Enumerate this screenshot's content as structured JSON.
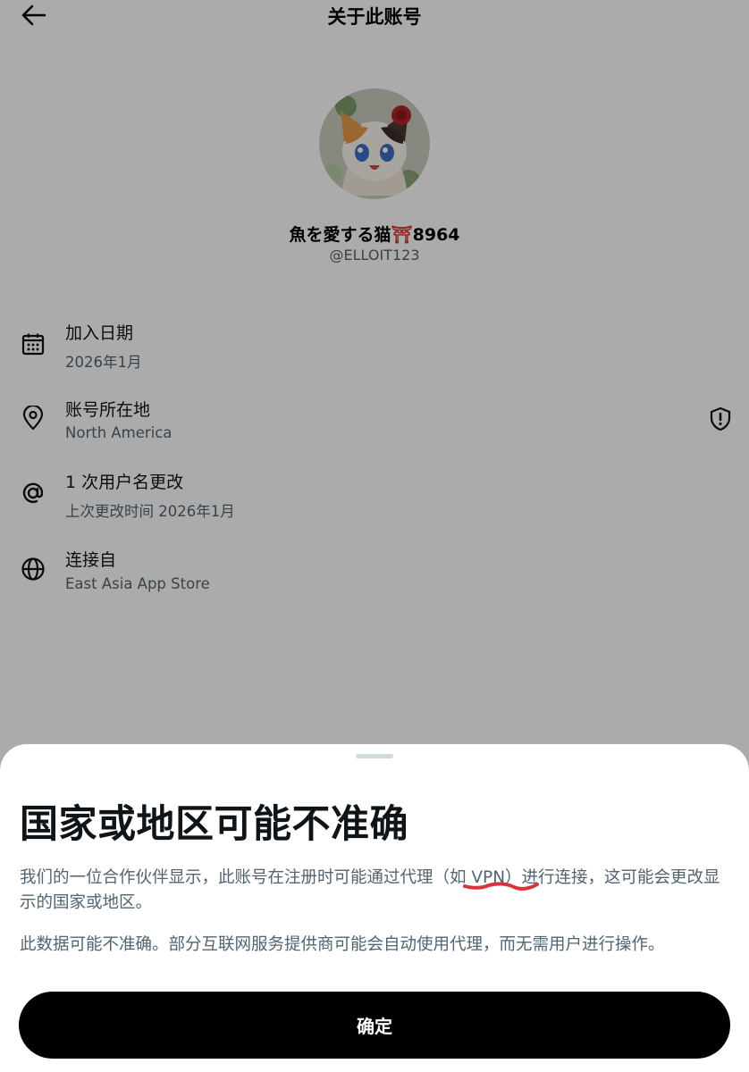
{
  "header": {
    "title": "关于此账号",
    "back_icon": "arrow-left-icon"
  },
  "profile": {
    "display_name": "魚を愛する猫",
    "display_name_emoji": "⛩",
    "display_name_suffix": "8964",
    "handle": "@ELLOIT123"
  },
  "info": [
    {
      "icon": "calendar-icon",
      "title": "加入日期",
      "value": "2026年1月"
    },
    {
      "icon": "location-pin-icon",
      "title": "账号所在地",
      "value": "North America"
    },
    {
      "icon": "at-sign-icon",
      "title": "1 次用户名更改",
      "value": "上次更改时间 2026年1月"
    },
    {
      "icon": "globe-icon",
      "title": "连接自",
      "value": "East Asia App Store"
    }
  ],
  "sheet": {
    "title": "国家或地区可能不准确",
    "paragraph1": "我们的一位合作伙伴显示，此账号在注册时可能通过代理（如 VPN）进行连接，这可能会更改显示的国家或地区。",
    "paragraph2": "此数据可能不准确。部分互联网服务提供商可能会自动使用代理，而无需用户进行操作。",
    "confirm_label": "确定"
  },
  "colors": {
    "overlay": "#000000",
    "secondary_text": "#536471",
    "primary_text": "#0f1419",
    "annotation_red": "#d8343e",
    "button_bg": "#000000"
  }
}
